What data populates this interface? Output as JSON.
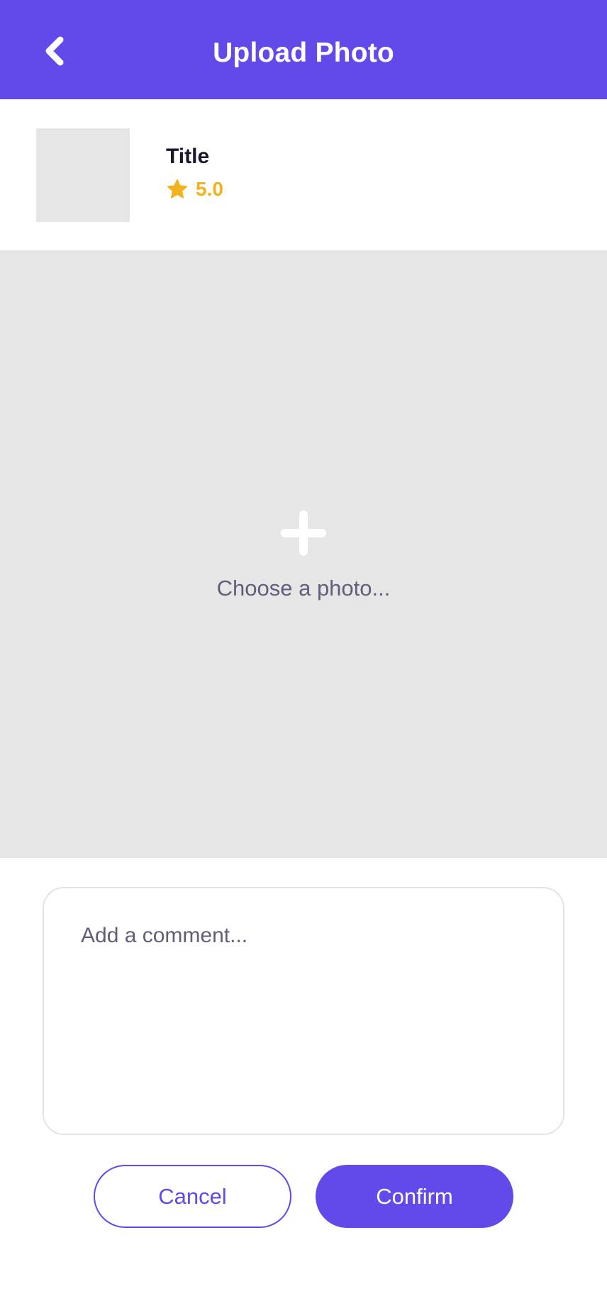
{
  "header": {
    "title": "Upload Photo",
    "back_icon": "chevron-left-icon"
  },
  "item": {
    "title": "Title",
    "rating": "5.0",
    "rating_icon": "star-icon"
  },
  "photo_picker": {
    "icon": "plus-icon",
    "label": "Choose a photo..."
  },
  "comment": {
    "placeholder": "Add a comment...",
    "value": ""
  },
  "actions": {
    "cancel_label": "Cancel",
    "confirm_label": "Confirm"
  },
  "colors": {
    "primary": "#6249E9",
    "rating": "#F2B21C",
    "placeholder_bg": "#E6E6E7",
    "muted_text": "#615E7A",
    "title_text": "#1B1733"
  }
}
